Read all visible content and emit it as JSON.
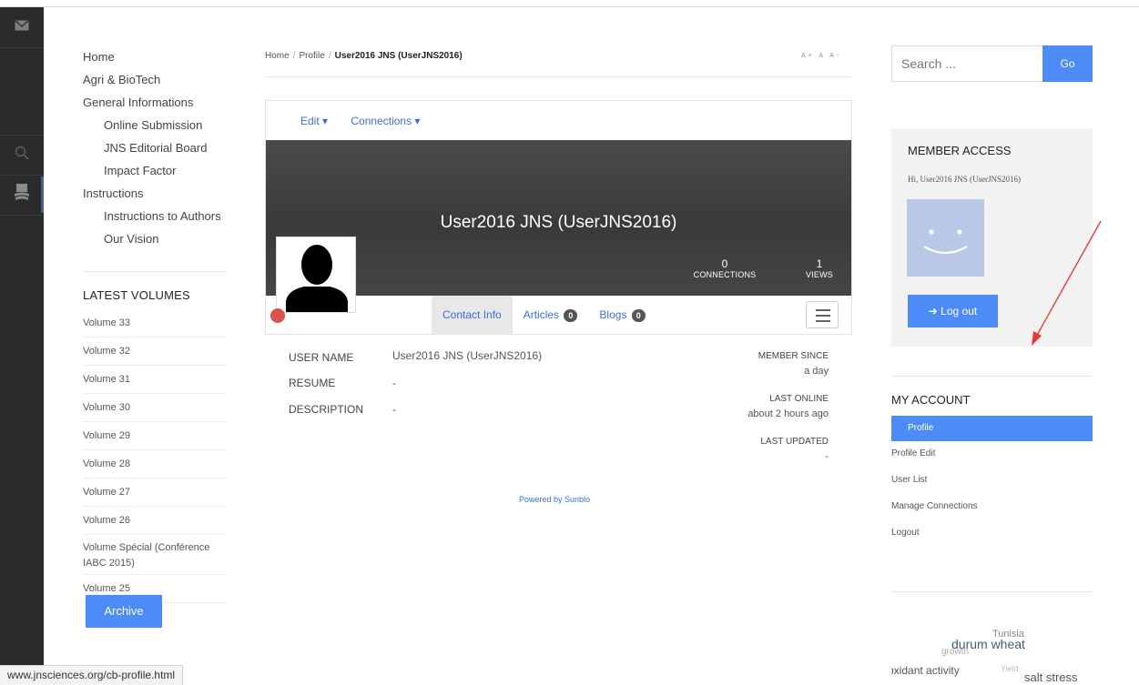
{
  "left_nav": {
    "items": [
      {
        "label": "Home",
        "level": 0
      },
      {
        "label": "Agri & BioTech",
        "level": 0
      },
      {
        "label": "General Informations",
        "level": 0
      },
      {
        "label": "Online Submission",
        "level": 1
      },
      {
        "label": "JNS Editorial Board",
        "level": 1
      },
      {
        "label": "Impact Factor",
        "level": 1
      },
      {
        "label": "Instructions",
        "level": 0
      },
      {
        "label": "Instructions to Authors",
        "level": 1
      },
      {
        "label": "Our Vision",
        "level": 1
      }
    ]
  },
  "latest_volumes": {
    "title": "LATEST VOLUMES",
    "items": [
      "Volume 33",
      "Volume 32",
      "Volume 31",
      "Volume 30",
      "Volume 29",
      "Volume 28",
      "Volume 27",
      "Volume 26",
      "Volume Spécial (Conférence IABC 2015)",
      "Volume 25"
    ],
    "archive_label": "Archive"
  },
  "breadcrumb": {
    "home": "Home",
    "profile": "Profile",
    "current": "User2016 JNS (UserJNS2016)",
    "font_sizer": "A+ A A-"
  },
  "profile": {
    "menu": {
      "edit": "Edit ▾",
      "connections": "Connections ▾"
    },
    "display_name": "User2016 JNS (UserJNS2016)",
    "stats": {
      "connections_value": "0",
      "connections_label": "CONNECTIONS",
      "views_value": "1",
      "views_label": "VIEWS"
    },
    "tabs": {
      "contact": "Contact Info",
      "articles": "Articles",
      "articles_count": "0",
      "blogs": "Blogs",
      "blogs_count": "0"
    },
    "fields": {
      "username_label": "USER NAME",
      "username_value": "User2016 JNS (UserJNS2016)",
      "resume_label": "RESUME",
      "resume_value": "-",
      "description_label": "DESCRIPTION",
      "description_value": "-"
    },
    "meta": {
      "member_since_label": "MEMBER SINCE",
      "member_since_value": "a day",
      "last_online_label": "LAST ONLINE",
      "last_online_value": "about 2 hours ago",
      "last_updated_label": "LAST UPDATED",
      "last_updated_value": "-"
    },
    "powered_by": "Powered by Sunblo"
  },
  "search": {
    "placeholder": "Search ...",
    "button": "Go"
  },
  "member_access": {
    "title": "MEMBER ACCESS",
    "greeting": "Hi, User2016 JNS (UserJNS2016)",
    "logout_button": "Log out"
  },
  "my_account": {
    "title": "MY ACCOUNT",
    "items": [
      "Profile",
      "Profile Edit",
      "User List",
      "Manage Connections",
      "Logout"
    ],
    "active_index": 0
  },
  "tag_cloud": {
    "tags": [
      "durum wheat",
      "Tunisia",
      "growth",
      "oxidant activity",
      "Yield",
      "salt stress"
    ]
  },
  "status_bar": {
    "url": "www.jnsciences.org/cb-profile.html"
  },
  "colors": {
    "accent": "#4d8cf6",
    "link": "#3a6fd0",
    "rail": "#2b2b2b",
    "annotation": "#e53935"
  }
}
